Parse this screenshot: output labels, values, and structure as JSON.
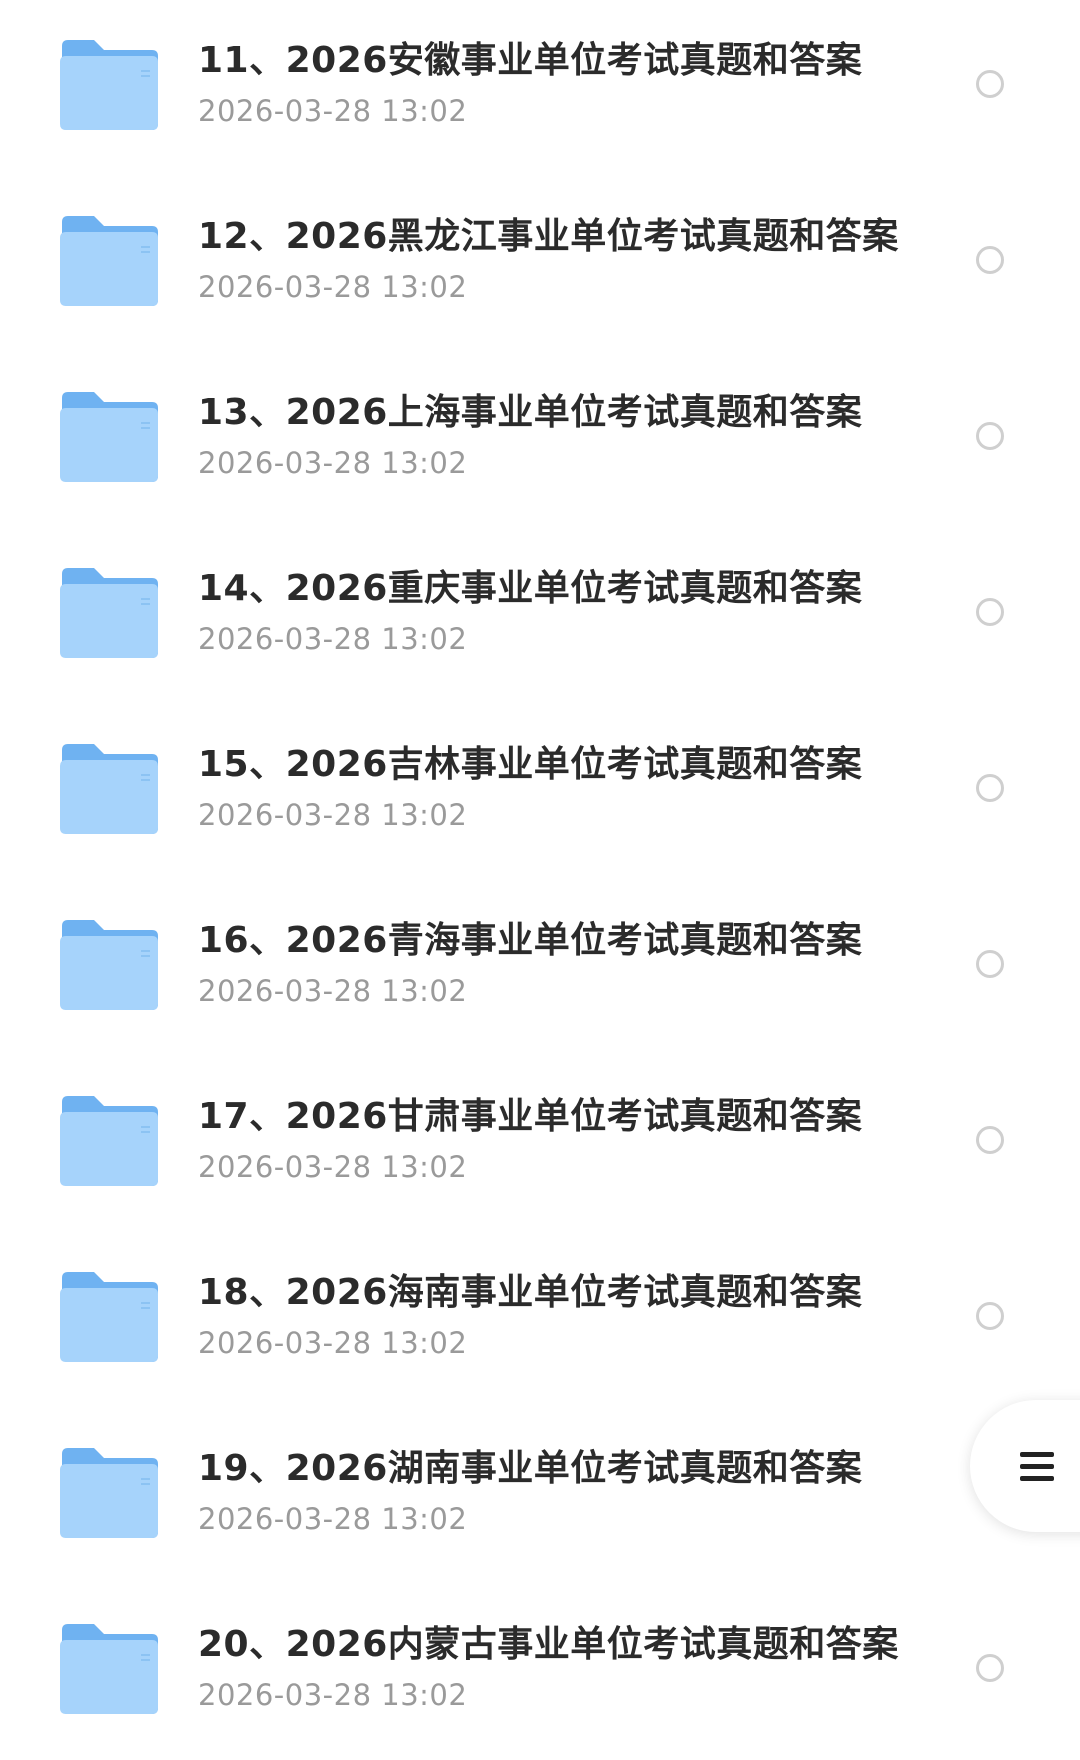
{
  "files": [
    {
      "title": "11、2026安徽事业单位考试真题和答案",
      "date": "2026-03-28 13:02"
    },
    {
      "title": "12、2026黑龙江事业单位考试真题和答案",
      "date": "2026-03-28 13:02"
    },
    {
      "title": "13、2026上海事业单位考试真题和答案",
      "date": "2026-03-28 13:02"
    },
    {
      "title": "14、2026重庆事业单位考试真题和答案",
      "date": "2026-03-28 13:02"
    },
    {
      "title": "15、2026吉林事业单位考试真题和答案",
      "date": "2026-03-28 13:02"
    },
    {
      "title": "16、2026青海事业单位考试真题和答案",
      "date": "2026-03-28 13:02"
    },
    {
      "title": "17、2026甘肃事业单位考试真题和答案",
      "date": "2026-03-28 13:02"
    },
    {
      "title": "18、2026海南事业单位考试真题和答案",
      "date": "2026-03-28 13:02"
    },
    {
      "title": "19、2026湖南事业单位考试真题和答案",
      "date": "2026-03-28 13:02"
    },
    {
      "title": "20、2026内蒙古事业单位考试真题和答案",
      "date": "2026-03-28 13:02"
    }
  ],
  "icons": {
    "folder": "folder-icon",
    "select": "radio-circle-icon",
    "menu": "menu-lines-icon"
  },
  "colors": {
    "folder_front": "#9fd0fb",
    "folder_back": "#6fb2f1",
    "title_text": "#2b2b2b",
    "date_text": "#9a9a9a",
    "radio_border": "#cfcfcf"
  }
}
